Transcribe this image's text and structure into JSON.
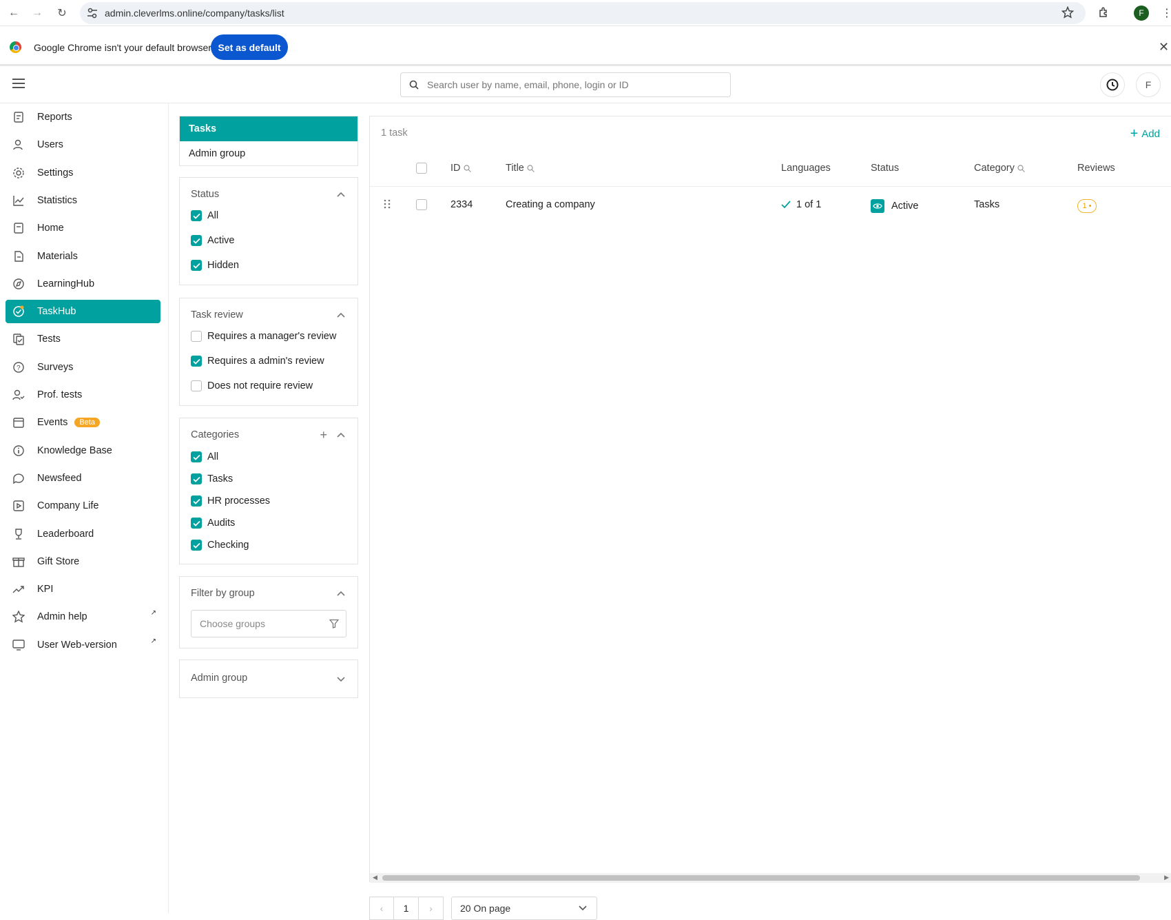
{
  "browser": {
    "url": "admin.cleverlms.online/company/tasks/list",
    "profile_initial": "F"
  },
  "infobar": {
    "message": "Google Chrome isn't your default browser",
    "button": "Set as default"
  },
  "header": {
    "search_placeholder": "Search user by name, email, phone, login or ID",
    "avatar_initial": "F"
  },
  "sidebar": {
    "items": [
      {
        "label": "Reports",
        "icon": "reports-icon"
      },
      {
        "label": "Users",
        "icon": "users-icon"
      },
      {
        "label": "Settings",
        "icon": "gear-icon"
      },
      {
        "label": "Statistics",
        "icon": "chart-line-icon"
      },
      {
        "label": "Home",
        "icon": "home-icon"
      },
      {
        "label": "Materials",
        "icon": "document-icon"
      },
      {
        "label": "LearningHub",
        "icon": "compass-icon"
      },
      {
        "label": "TaskHub",
        "icon": "task-check-icon",
        "active": true
      },
      {
        "label": "Tests",
        "icon": "test-icon"
      },
      {
        "label": "Surveys",
        "icon": "survey-icon"
      },
      {
        "label": "Prof. tests",
        "icon": "user-check-icon"
      },
      {
        "label": "Events",
        "icon": "calendar-icon",
        "badge": "Beta"
      },
      {
        "label": "Knowledge Base",
        "icon": "info-icon"
      },
      {
        "label": "Newsfeed",
        "icon": "chat-icon"
      },
      {
        "label": "Company Life",
        "icon": "play-icon"
      },
      {
        "label": "Leaderboard",
        "icon": "trophy-icon"
      },
      {
        "label": "Gift Store",
        "icon": "gift-icon"
      },
      {
        "label": "KPI",
        "icon": "trend-icon"
      },
      {
        "label": "Admin help",
        "icon": "star-icon",
        "external": true
      },
      {
        "label": "User Web-version",
        "icon": "monitor-icon",
        "external": true
      }
    ]
  },
  "tabs": {
    "active": "Tasks",
    "other": "Admin group"
  },
  "filters": {
    "status": {
      "title": "Status",
      "options": [
        {
          "label": "All",
          "checked": true
        },
        {
          "label": "Active",
          "checked": true
        },
        {
          "label": "Hidden",
          "checked": true
        }
      ]
    },
    "task_review": {
      "title": "Task review",
      "options": [
        {
          "label": "Requires a manager's review",
          "checked": false
        },
        {
          "label": "Requires a admin's review",
          "checked": true
        },
        {
          "label": "Does not require review",
          "checked": false
        }
      ]
    },
    "categories": {
      "title": "Categories",
      "options": [
        {
          "label": "All",
          "checked": true
        },
        {
          "label": "Tasks",
          "checked": true
        },
        {
          "label": "HR processes",
          "checked": true
        },
        {
          "label": "Audits",
          "checked": true
        },
        {
          "label": "Checking",
          "checked": true
        }
      ]
    },
    "group": {
      "title": "Filter by group",
      "placeholder": "Choose groups"
    },
    "admin_group": {
      "title": "Admin group"
    }
  },
  "table": {
    "count_label": "1 task",
    "add_label": "Add",
    "columns": [
      "ID",
      "Title",
      "Languages",
      "Status",
      "Category",
      "Reviews"
    ],
    "rows": [
      {
        "id": "2334",
        "title": "Creating a company",
        "languages": "1 of 1",
        "status": "Active",
        "category": "Tasks",
        "reviews": "1"
      }
    ]
  },
  "pagination": {
    "page": "1",
    "page_size": "20 On page"
  },
  "colors": {
    "accent": "#00a19f",
    "beta": "#f5a623",
    "chrome_button": "#0b57d0"
  }
}
